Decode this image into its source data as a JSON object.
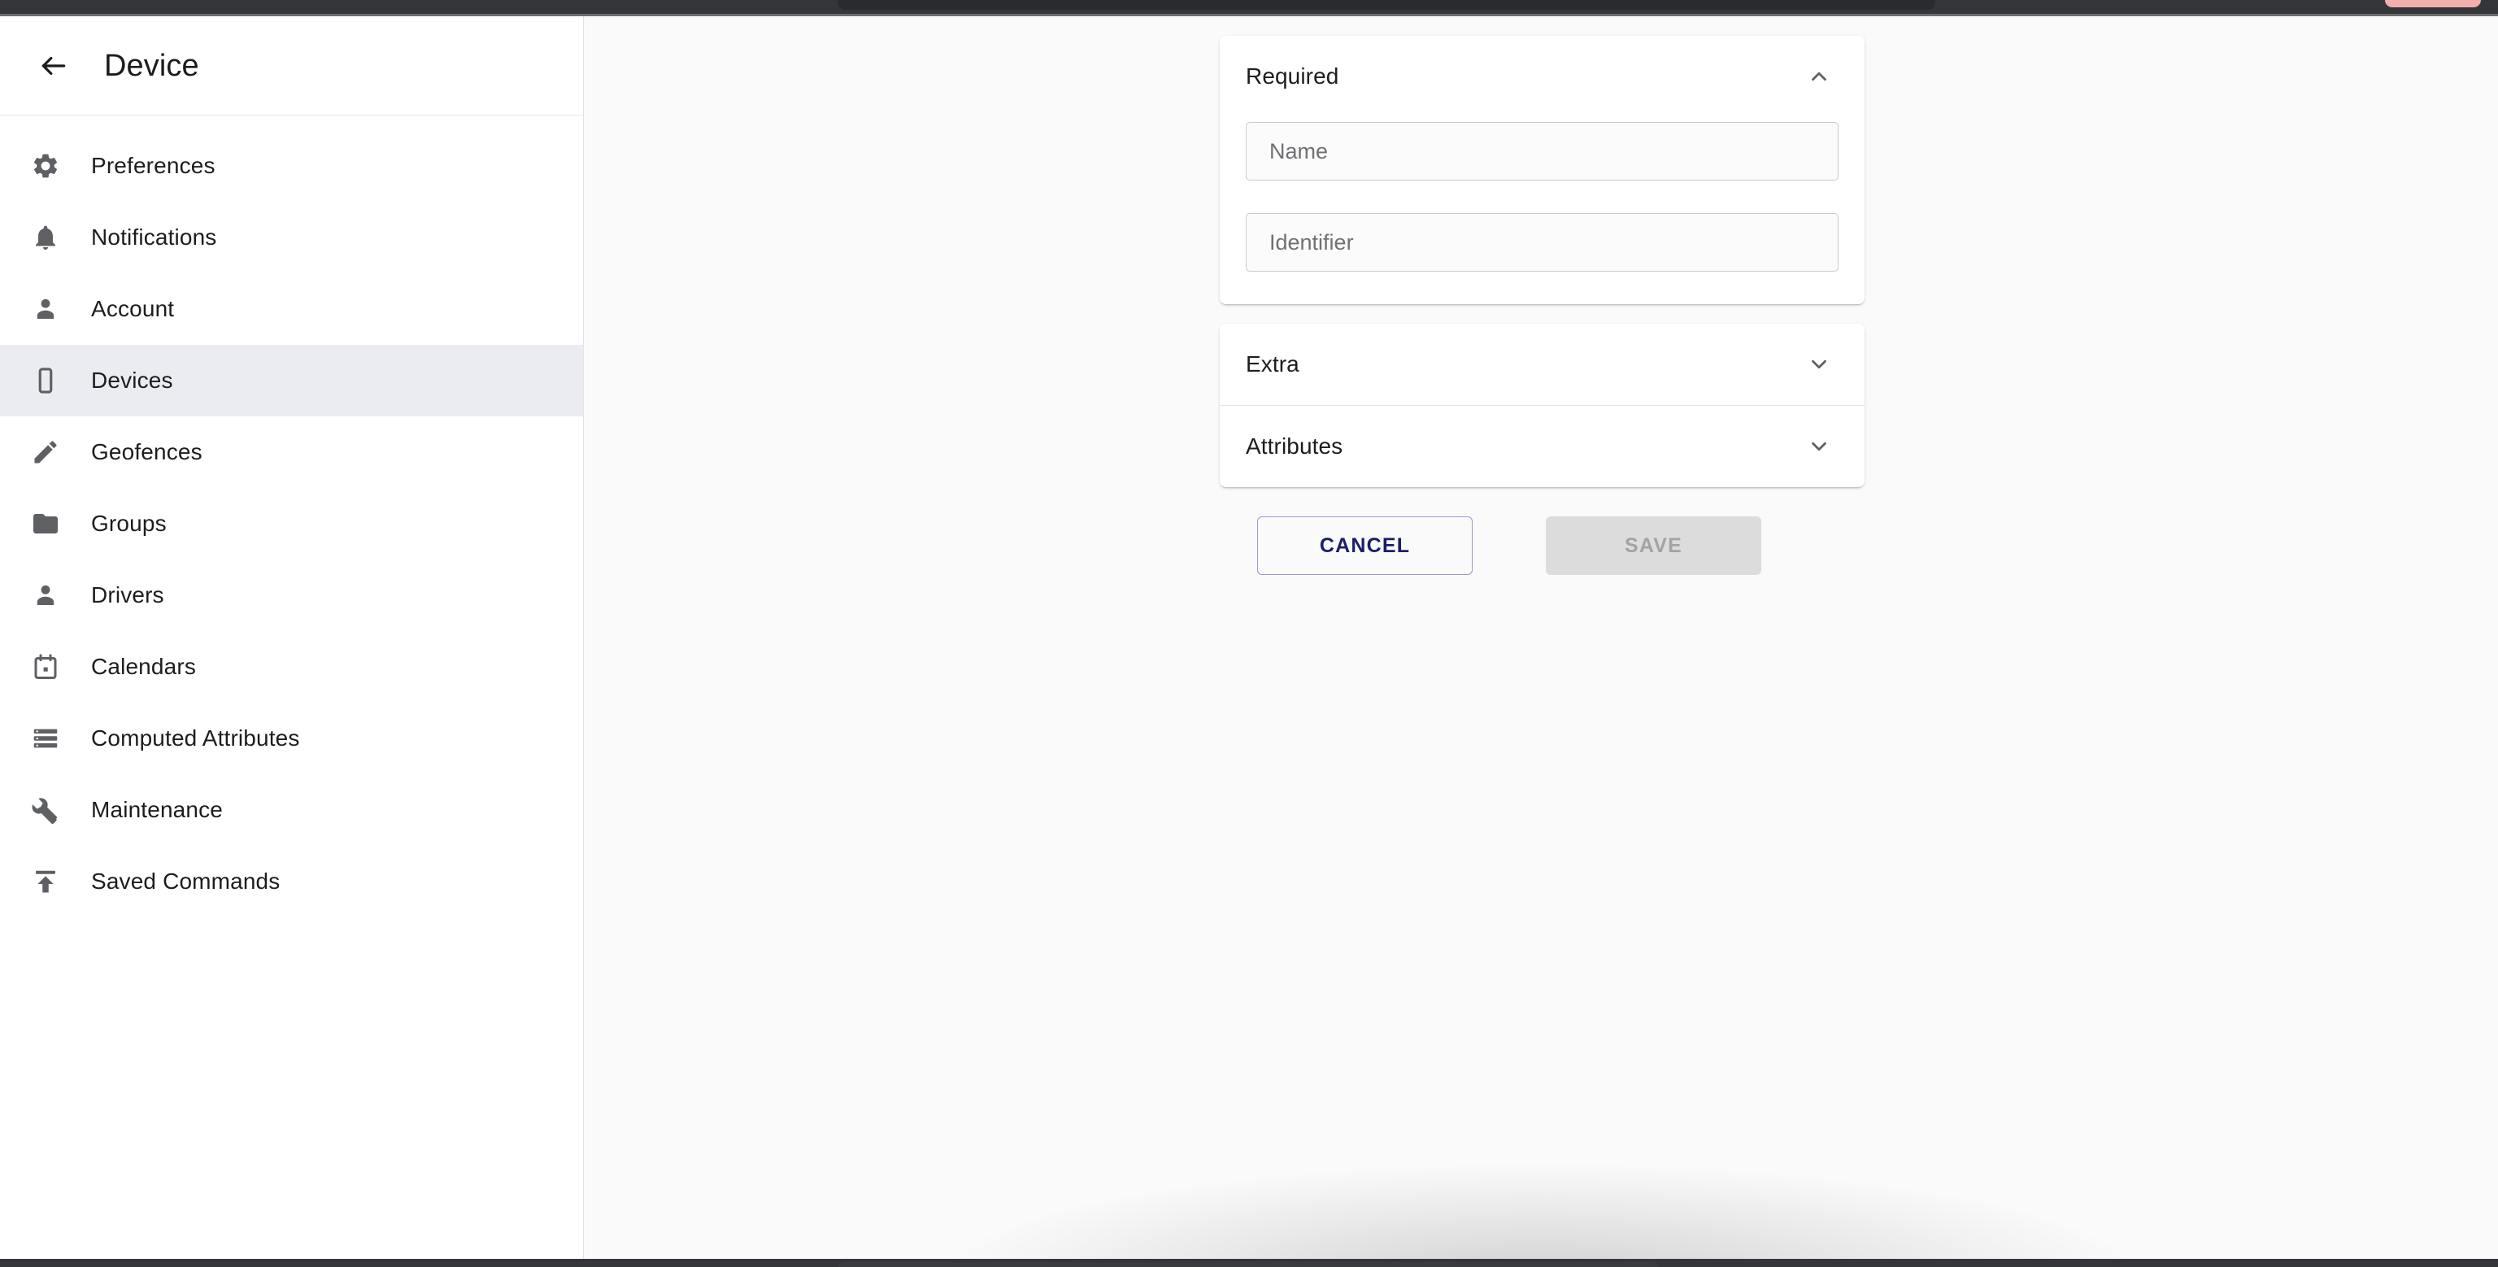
{
  "window": {
    "chrome_color": "#35363a",
    "accent_tab_color": "#f3aeae"
  },
  "sidebar": {
    "title": "Device",
    "back_icon": "arrow-back-icon",
    "items": [
      {
        "label": "Preferences",
        "icon": "gear-icon",
        "selected": false
      },
      {
        "label": "Notifications",
        "icon": "bell-icon",
        "selected": false
      },
      {
        "label": "Account",
        "icon": "person-icon",
        "selected": false
      },
      {
        "label": "Devices",
        "icon": "smartphone-icon",
        "selected": true
      },
      {
        "label": "Geofences",
        "icon": "pencil-icon",
        "selected": false
      },
      {
        "label": "Groups",
        "icon": "folder-icon",
        "selected": false
      },
      {
        "label": "Drivers",
        "icon": "person-icon",
        "selected": false
      },
      {
        "label": "Calendars",
        "icon": "calendar-icon",
        "selected": false
      },
      {
        "label": "Computed Attributes",
        "icon": "storage-list-icon",
        "selected": false
      },
      {
        "label": "Maintenance",
        "icon": "wrench-icon",
        "selected": false
      },
      {
        "label": "Saved Commands",
        "icon": "upload-icon",
        "selected": false
      }
    ]
  },
  "form": {
    "sections": {
      "required": {
        "title": "Required",
        "expanded": true,
        "chevron_icon": "chevron-up-icon",
        "fields": {
          "name": {
            "placeholder": "Name",
            "value": ""
          },
          "identifier": {
            "placeholder": "Identifier",
            "value": ""
          }
        }
      },
      "extra": {
        "title": "Extra",
        "expanded": false,
        "chevron_icon": "chevron-down-icon"
      },
      "attributes": {
        "title": "Attributes",
        "expanded": false,
        "chevron_icon": "chevron-down-icon"
      }
    },
    "actions": {
      "cancel_label": "CANCEL",
      "save_label": "SAVE",
      "save_disabled": true,
      "cancel_text_color": "#1b1e66",
      "save_bg_color": "#dcdcdc"
    }
  }
}
